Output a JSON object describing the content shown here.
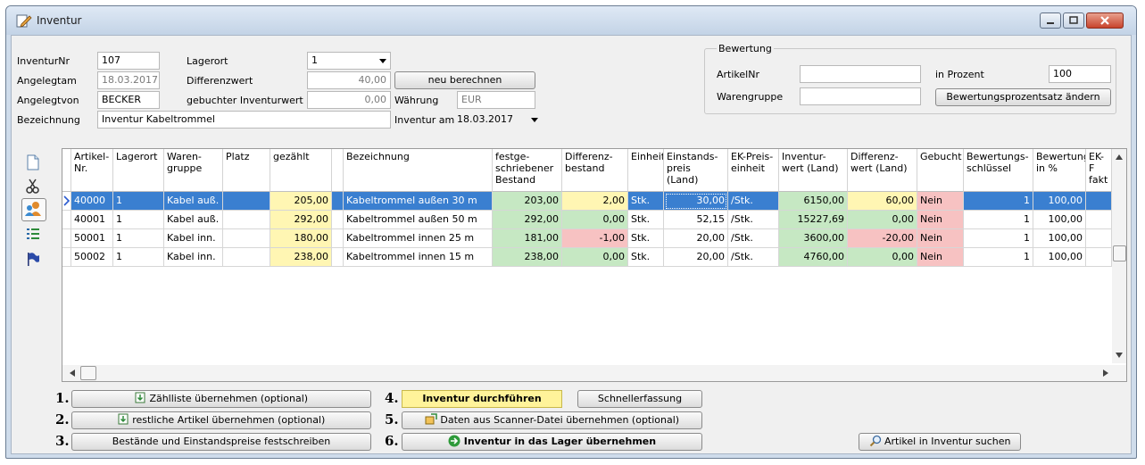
{
  "window": {
    "title": "Inventur"
  },
  "form": {
    "inventurnr_label": "InventurNr",
    "inventurnr": "107",
    "angelegtam_label": "Angelegtam",
    "angelegtam": "18.03.2017",
    "angelegtvon_label": "Angelegtvon",
    "angelegtvon": "BECKER",
    "bezeichnung_label": "Bezeichnung",
    "bezeichnung": "Inventur Kabeltrommel",
    "lagerort_label": "Lagerort",
    "lagerort": "1",
    "differenzwert_label": "Differenzwert",
    "differenzwert": "40,00",
    "gebuchter_label": "gebuchter Inventurwert",
    "gebuchter": "0,00",
    "neu_berechnen": "neu berechnen",
    "waehrung_label": "Währung",
    "waehrung": "EUR",
    "inventur_am_label": "Inventur am",
    "inventur_am": "18.03.2017"
  },
  "bewertung": {
    "group_label": "Bewertung",
    "artikelnr_label": "ArtikelNr",
    "artikelnr": "",
    "warengruppe_label": "Warengruppe",
    "warengruppe": "",
    "prozent_label": "in Prozent",
    "prozent": "100",
    "aendern_button": "Bewertungsprozentsatz ändern"
  },
  "grid": {
    "columns": [
      {
        "line1": "Artikel-",
        "line2": "Nr.",
        "line3": ""
      },
      {
        "line1": "Lagerort",
        "line2": "",
        "line3": ""
      },
      {
        "line1": "Waren-",
        "line2": "gruppe",
        "line3": ""
      },
      {
        "line1": "Platz",
        "line2": "",
        "line3": ""
      },
      {
        "line1": "gezählt",
        "line2": "",
        "line3": ""
      },
      {
        "line1": "",
        "line2": "",
        "line3": ""
      },
      {
        "line1": "Bezeichnung",
        "line2": "",
        "line3": ""
      },
      {
        "line1": "festge-",
        "line2": "schriebener",
        "line3": "Bestand"
      },
      {
        "line1": "Differenz-",
        "line2": "bestand",
        "line3": ""
      },
      {
        "line1": "Einheit",
        "line2": "",
        "line3": ""
      },
      {
        "line1": "Einstands-",
        "line2": "preis (Land)",
        "line3": ""
      },
      {
        "line1": "EK-Preis-",
        "line2": "einheit",
        "line3": ""
      },
      {
        "line1": "Inventur-",
        "line2": "wert (Land)",
        "line3": ""
      },
      {
        "line1": "Differenz-",
        "line2": "wert (Land)",
        "line3": ""
      },
      {
        "line1": "Gebucht",
        "line2": "",
        "line3": ""
      },
      {
        "line1": "Bewertungs-",
        "line2": "schlüssel",
        "line3": ""
      },
      {
        "line1": "Bewertung",
        "line2": "in %",
        "line3": ""
      },
      {
        "line1": "EK-F",
        "line2": "fakt",
        "line3": ""
      }
    ],
    "rows": [
      {
        "artikel": "40000",
        "lagerort": "1",
        "warengruppe": "Kabel auß.",
        "platz": "",
        "gezaehlt": "205,00",
        "bezeichnung": "Kabeltrommel außen 30 m",
        "bestand": "203,00",
        "diffbestand": "2,00",
        "einheit": "Stk.",
        "einstandspreis": "30,00",
        "ekpreiseinheit": "/Stk.",
        "inventurwert": "6150,00",
        "differenzwert": "60,00",
        "gebucht": "Nein",
        "schluessel": "1",
        "bewertung": "100,00"
      },
      {
        "artikel": "40001",
        "lagerort": "1",
        "warengruppe": "Kabel auß.",
        "platz": "",
        "gezaehlt": "292,00",
        "bezeichnung": "Kabeltrommel außen 50 m",
        "bestand": "292,00",
        "diffbestand": "0,00",
        "einheit": "Stk.",
        "einstandspreis": "52,15",
        "ekpreiseinheit": "/Stk.",
        "inventurwert": "15227,69",
        "differenzwert": "0,00",
        "gebucht": "Nein",
        "schluessel": "1",
        "bewertung": "100,00"
      },
      {
        "artikel": "50001",
        "lagerort": "1",
        "warengruppe": "Kabel inn.",
        "platz": "",
        "gezaehlt": "180,00",
        "bezeichnung": "Kabeltrommel innen 25 m",
        "bestand": "181,00",
        "diffbestand": "-1,00",
        "einheit": "Stk.",
        "einstandspreis": "20,00",
        "ekpreiseinheit": "/Stk.",
        "inventurwert": "3600,00",
        "differenzwert": "-20,00",
        "gebucht": "Nein",
        "schluessel": "1",
        "bewertung": "100,00"
      },
      {
        "artikel": "50002",
        "lagerort": "1",
        "warengruppe": "Kabel inn.",
        "platz": "",
        "gezaehlt": "238,00",
        "bezeichnung": "Kabeltrommel innen 15 m",
        "bestand": "238,00",
        "diffbestand": "0,00",
        "einheit": "Stk.",
        "einstandspreis": "20,00",
        "ekpreiseinheit": "/Stk.",
        "inventurwert": "4760,00",
        "differenzwert": "0,00",
        "gebucht": "Nein",
        "schluessel": "1",
        "bewertung": "100,00"
      }
    ]
  },
  "colors": {
    "selected_row": "#3a7fd0",
    "yellow": "#fff6b3",
    "green": "#c6e8c3",
    "red": "#f7c2c2"
  },
  "steps": {
    "n1": "1.",
    "b1": "Zählliste übernehmen (optional)",
    "n2": "2.",
    "b2": "restliche Artikel übernehmen (optional)",
    "n3": "3.",
    "b3": "Bestände und Einstandspreise festschreiben",
    "n4": "4.",
    "b4": "Inventur durchführen",
    "schnell": "Schnellerfassung",
    "n5": "5.",
    "b5": "Daten aus Scanner-Datei übernehmen (optional)",
    "n6": "6.",
    "b6": "Inventur in das Lager übernehmen",
    "suchen": "Artikel in Inventur suchen"
  }
}
